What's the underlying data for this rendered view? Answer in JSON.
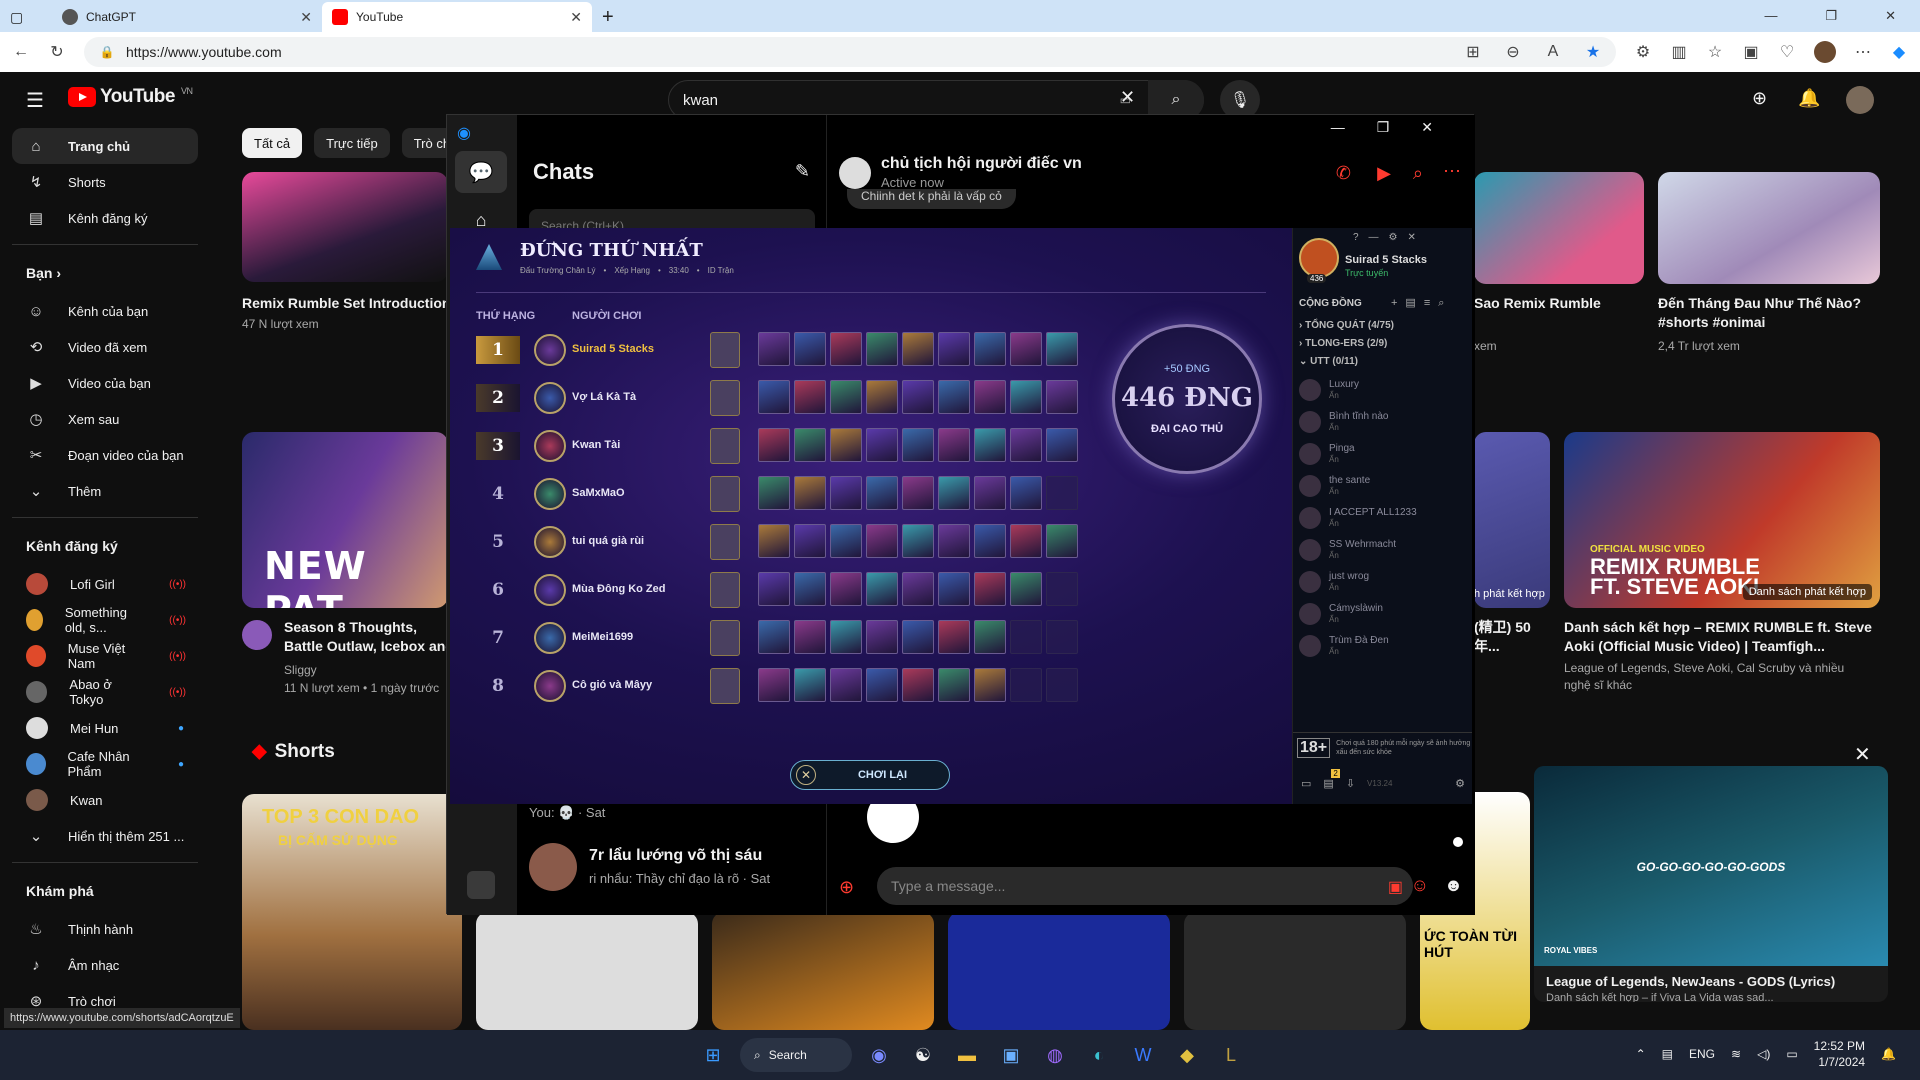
{
  "browser": {
    "tabs": [
      {
        "label": "ChatGPT"
      },
      {
        "label": "YouTube"
      }
    ],
    "url": "https://www.youtube.com"
  },
  "youtube": {
    "region": "VN",
    "logo_text": "YouTube",
    "search_value": "kwan",
    "chips": [
      "Tất cả",
      "Trực tiếp",
      "Trò chơi"
    ],
    "sidebar": {
      "main": [
        "Trang chủ",
        "Shorts",
        "Kênh đăng ký"
      ],
      "you_head": "Bạn",
      "you_items": [
        "Kênh của bạn",
        "Video đã xem",
        "Video của bạn",
        "Xem sau",
        "Đoạn video của bạn",
        "Thêm"
      ],
      "subs_head": "Kênh đăng ký",
      "subs": [
        "Lofi Girl",
        "Something old, s...",
        "Muse Việt Nam",
        "Abao ở Tokyo",
        "Mei Hun",
        "Cafe Nhân Phẩm",
        "Kwan",
        "Hiển thị thêm 251 ..."
      ],
      "explore_head": "Khám phá",
      "explore": [
        "Thịnh hành",
        "Âm nhạc",
        "Trò chơi"
      ]
    },
    "videos": {
      "v1_title": "Remix Rumble Set Introduction",
      "v1_meta": "47 N lượt xem",
      "v2_title": "Sao Remix Rumble",
      "v2_meta": "xem",
      "v3_title": "Đến Tháng Đau Như Thế Nào? #shorts #onimai",
      "v3_meta": "2,4 Tr lượt xem",
      "v4_thumb": "NEW PAT",
      "v4_title": "Season 8 Thoughts, Battle Outlaw, Icebox and Lotus",
      "v4_channel": "Sliggy",
      "v4_meta": "11 N lượt xem • 1 ngày trước",
      "v5_title": "(精卫) 50年...",
      "v5_badge": "h phát kết hợp",
      "v6_title": "Danh sách kết hợp – REMIX RUMBLE ft. Steve Aoki (Official Music Video) | Teamfigh...",
      "v6_meta": "League of Legends, Steve Aoki, Cal Scruby và nhiều nghệ sĩ khác",
      "v6_badge": "Danh sách phát kết hợp",
      "v6_thumb_line1": "OFFICIAL MUSIC VIDEO",
      "v6_thumb_line2": "REMIX RUMBLE",
      "v6_thumb_line3": "FT. STEVE AOKI"
    },
    "shorts_head": "Shorts",
    "short1_text1": "TOP 3 CON DAO",
    "short1_text2": "BỊ CẤM SỬ DỤNG",
    "short_partial": "ỨC TOÀN TỪI HÚT",
    "miniplayer": {
      "overlay": "GO-GO-GO-GO-GO-GODS",
      "label": "ROYAL VIBES",
      "title": "League of Legends, NewJeans - GODS (Lyrics)",
      "subtitle": "Danh sách kết hợp – if Viva La Vida was sad..."
    },
    "status_url": "https://www.youtube.com/shorts/adCAorqtzuE"
  },
  "messenger": {
    "list_title": "Chats",
    "search_placeholder": "Search (Ctrl+K)",
    "chat_name": "chủ tịch hội người điếc vn",
    "chat_status": "Active now",
    "bubble_text": "Chiinh det k phải là vấp cỏ",
    "prev_preview": "You: 💀 · Sat",
    "row2_name": "7r lẩu lướng võ thị sáu",
    "row2_preview": "ri nhẩu: Thầy chỉ đạo là rõ · Sat",
    "input_placeholder": "Type a message..."
  },
  "tft": {
    "title": "ĐỨNG THỨ NHẤT",
    "subtitle_mode": "Đấu Trường Chân Lý",
    "subtitle_ranked": "Xếp Hạng",
    "subtitle_time": "33:40",
    "subtitle_id": "ID Trận",
    "col_rank": "THỨ HẠNG",
    "col_player": "NGƯỜI CHƠI",
    "players": [
      {
        "rank": "1",
        "name": "Suirad 5 Stacks",
        "units": 9
      },
      {
        "rank": "2",
        "name": "Vợ Lá Kà Tà",
        "units": 9
      },
      {
        "rank": "3",
        "name": "Kwan Tài",
        "units": 9
      },
      {
        "rank": "4",
        "name": "SaMxMaO",
        "units": 8
      },
      {
        "rank": "5",
        "name": "tui quá già rùi",
        "units": 9
      },
      {
        "rank": "6",
        "name": "Mùa Đông Ko Zed",
        "units": 8
      },
      {
        "rank": "7",
        "name": "MeiMei1699",
        "units": 7
      },
      {
        "rank": "8",
        "name": "Cô gió và Mâyy",
        "units": 7
      }
    ],
    "lp_gain": "+50 ĐNG",
    "lp_total": "446 ĐNG",
    "tier": "ĐẠI CAO THỦ",
    "play_again": "CHƠI LẠI",
    "side": {
      "player_name": "Suirad 5 Stacks",
      "player_status": "Trực tuyến",
      "level": "436",
      "community": "CỘNG ĐỒNG",
      "group1": "TỔNG QUÁT (4/75)",
      "group2": "TLONG-ERS (2/9)",
      "group3": "UTT (0/11)",
      "friends": [
        {
          "name": "Luxury",
          "status": "Ẩn"
        },
        {
          "name": "Bình tĩnh nào",
          "status": "Ẩn"
        },
        {
          "name": "Pinga",
          "status": "Ẩn"
        },
        {
          "name": "the sante",
          "status": "Ẩn"
        },
        {
          "name": "I ACCEPT ALL1233",
          "status": "Ẩn"
        },
        {
          "name": "SS Wehrmacht",
          "status": "Ẩn"
        },
        {
          "name": "just wrog",
          "status": "Ẩn"
        },
        {
          "name": "Cámyslàwin",
          "status": "Ẩn"
        },
        {
          "name": "Trùm Đà Đen",
          "status": "Ẩn"
        }
      ],
      "age_rating": "18+",
      "age_warning": "Chơi quá 180 phút mỗi ngày sẽ ảnh hưởng xấu đến sức khỏe",
      "version": "V13.24",
      "badge_count": "2"
    }
  },
  "taskbar": {
    "search": "Search",
    "lang": "ENG",
    "time": "12:52 PM",
    "date": "1/7/2024"
  },
  "colors": {
    "yt_red": "#ff0000",
    "tft_gold": "#f0c040",
    "messenger_red": "#ff3b30"
  }
}
